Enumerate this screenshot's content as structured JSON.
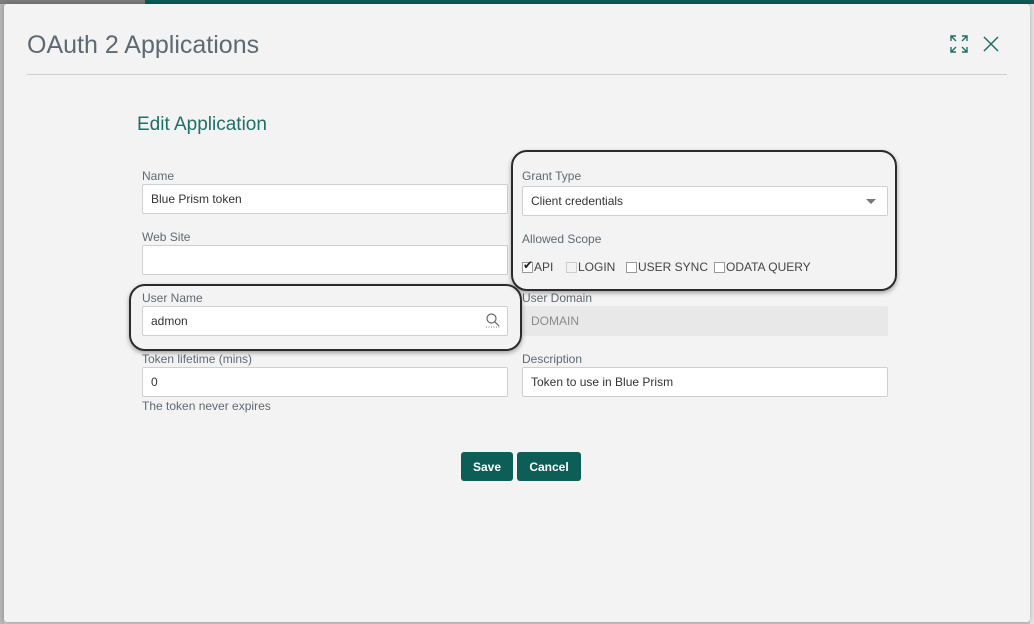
{
  "modal": {
    "title": "OAuth 2 Applications"
  },
  "form": {
    "section_title": "Edit Application",
    "name": {
      "label": "Name",
      "value": "Blue Prism token"
    },
    "web_site": {
      "label": "Web Site",
      "value": ""
    },
    "user_name": {
      "label": "User Name",
      "value": "admon"
    },
    "token_lifetime": {
      "label": "Token lifetime (mins)",
      "value": "0",
      "helper": "The token never expires"
    },
    "grant_type": {
      "label": "Grant Type",
      "value": "Client credentials"
    },
    "allowed_scope": {
      "label": "Allowed Scope",
      "options": [
        {
          "label": "API",
          "checked": true,
          "enabled": true
        },
        {
          "label": "LOGIN",
          "checked": false,
          "enabled": false
        },
        {
          "label": "USER SYNC",
          "checked": false,
          "enabled": true
        },
        {
          "label": "ODATA QUERY",
          "checked": false,
          "enabled": true
        }
      ]
    },
    "user_domain": {
      "label": "User Domain",
      "value": "DOMAIN"
    },
    "description": {
      "label": "Description",
      "value": "Token to use in Blue Prism"
    }
  },
  "buttons": {
    "save": "Save",
    "cancel": "Cancel"
  },
  "icons": {
    "maximize": "expand-icon",
    "close": "close-icon",
    "search": "search-icon",
    "dropdown": "chevron-down-icon"
  },
  "colors": {
    "accent": "#0e5e58",
    "title_text": "#5d6a72",
    "section_title": "#1f6f68",
    "modal_bg": "#f3f3f3"
  }
}
